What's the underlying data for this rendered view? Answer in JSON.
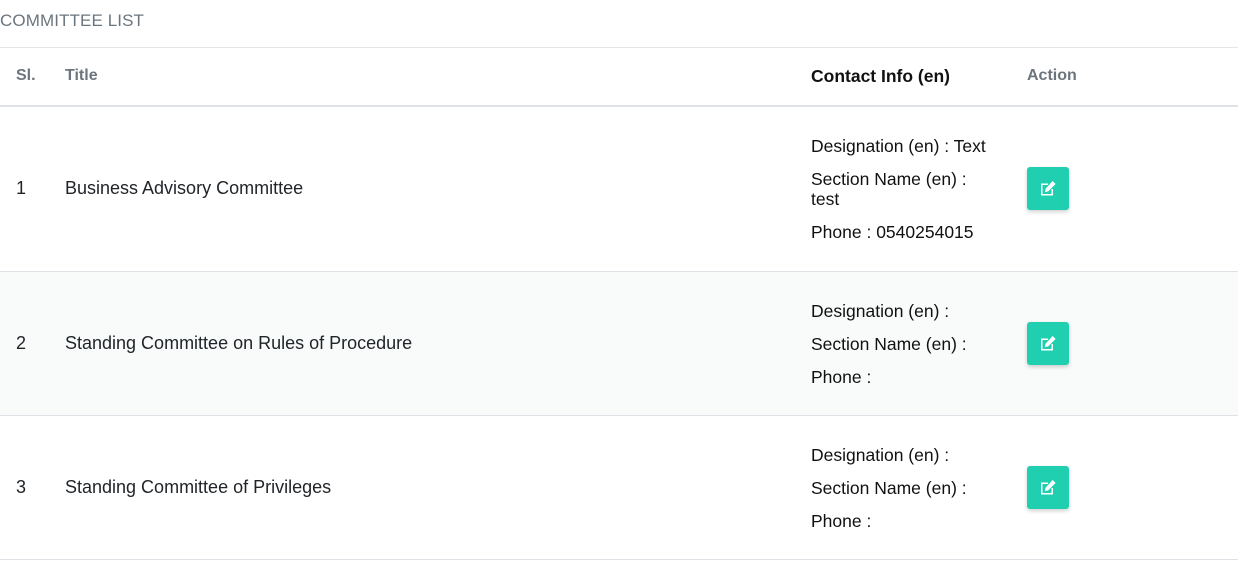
{
  "page": {
    "title": "COMMITTEE LIST"
  },
  "table": {
    "headers": {
      "sl": "Sl.",
      "title": "Title",
      "contact": "Contact Info (en)",
      "action": "Action"
    },
    "rows": [
      {
        "sl": "1",
        "title": "Business Advisory Committee",
        "designation": "Designation (en) : Text",
        "section": "Section Name (en) : test",
        "phone": "Phone : 0540254015"
      },
      {
        "sl": "2",
        "title": "Standing Committee on Rules of Procedure",
        "designation": "Designation (en) :",
        "section": "Section Name (en) :",
        "phone": "Phone :"
      },
      {
        "sl": "3",
        "title": "Standing Committee of Privileges",
        "designation": "Designation (en) :",
        "section": "Section Name (en) :",
        "phone": "Phone :"
      }
    ]
  },
  "icons": {
    "edit": "edit-icon"
  },
  "colors": {
    "action_button": "#1fcfb0",
    "stripe": "#f9fbfa",
    "header_text": "#6c757d"
  }
}
